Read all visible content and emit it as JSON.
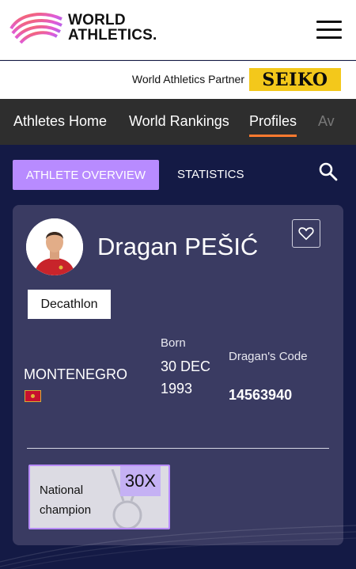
{
  "header": {
    "brand_line1": "WORLD",
    "brand_line2": "ATHLETICS.",
    "partner_text": "World Athletics Partner",
    "partner_logo": "SEIKO"
  },
  "nav": {
    "items": [
      "Athletes Home",
      "World Rankings",
      "Profiles",
      "Av"
    ],
    "active": "Profiles"
  },
  "tabs": {
    "overview": "ATHLETE OVERVIEW",
    "statistics": "STATISTICS"
  },
  "athlete": {
    "name": "Dragan PEŠIĆ",
    "discipline": "Decathlon",
    "country": "MONTENEGRO",
    "born_label": "Born",
    "born_value": "30 DEC 1993",
    "code_label": "Dragan's Code",
    "code_value": "14563940"
  },
  "honours": [
    {
      "label": "National champion",
      "count": "30X"
    }
  ],
  "colors": {
    "page_bg": "#141a45",
    "card_bg": "#3a3b62",
    "accent_purple": "#b88bff",
    "nav_bg": "#2e2e2e",
    "nav_active_underline": "#ff7a2f",
    "seiko_yellow": "#f3c81b"
  },
  "icons": [
    "world-athletics-logo",
    "hamburger-menu-icon",
    "search-icon",
    "heart-icon",
    "montenegro-flag",
    "medal-icon"
  ]
}
